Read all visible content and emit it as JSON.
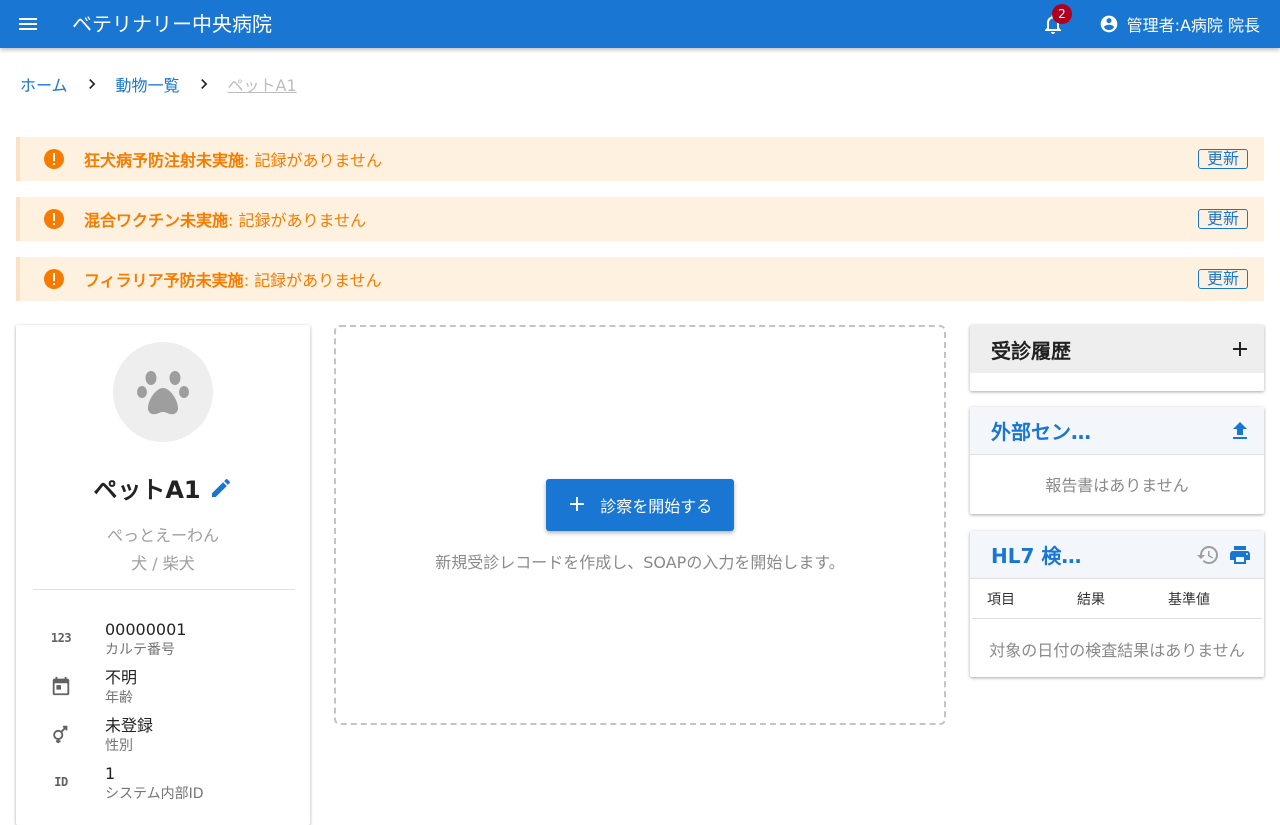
{
  "app": {
    "title": "ベテリナリー中央病院",
    "notification_count": "2",
    "user": "管理者:A病院 院長",
    "accent": "#1976d2"
  },
  "breadcrumb": [
    "ホーム",
    "動物一覧",
    "ペットA1"
  ],
  "alerts": [
    {
      "title": "狂犬病予防注射未実施",
      "message": ": 記録がありません",
      "button": "更新"
    },
    {
      "title": "混合ワクチン未実施",
      "message": ": 記録がありません",
      "button": "更新"
    },
    {
      "title": "フィラリア予防未実施",
      "message": ": 記録がありません",
      "button": "更新"
    }
  ],
  "pet": {
    "name": "ペットA1",
    "kana": "ぺっとえーわん",
    "species_breed": "犬 / 柴犬",
    "info": [
      {
        "icon": "numbers-icon",
        "value": "00000001",
        "label": "カルテ番号"
      },
      {
        "icon": "calendar-icon",
        "value": "不明",
        "label": "年齢"
      },
      {
        "icon": "gender-icon",
        "value": "未登録",
        "label": "性別"
      },
      {
        "icon": "id-icon",
        "value": "1",
        "label": "システム内部ID"
      }
    ]
  },
  "center": {
    "start_button": "診察を開始する",
    "hint": "新規受診レコードを作成し、SOAPの入力を開始します。"
  },
  "visit_history": {
    "title": "受診履歴"
  },
  "external_center": {
    "title": "外部セン…",
    "empty": "報告書はありません"
  },
  "hl7": {
    "title": "HL7 検…",
    "columns": [
      "項目",
      "結果",
      "基準値"
    ],
    "empty": "対象の日付の検査結果はありません"
  }
}
